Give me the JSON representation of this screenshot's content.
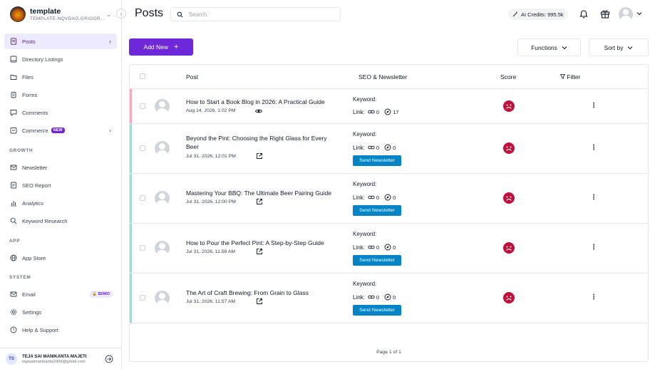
{
  "sidebar": {
    "brand_name": "template",
    "brand_subtitle": "TEMPLATE-NQVDAG.GRIGOR...",
    "items": [
      {
        "label": "Posts"
      },
      {
        "label": "Directory Listings"
      },
      {
        "label": "Files"
      },
      {
        "label": "Forms"
      },
      {
        "label": "Comments"
      },
      {
        "label": "Commerce",
        "badge": "NEW"
      },
      {
        "label": "Newsletter"
      },
      {
        "label": "SEO Report"
      },
      {
        "label": "Analytics"
      },
      {
        "label": "Keyword Research"
      },
      {
        "label": "App Store"
      },
      {
        "label": "Email",
        "badge": "$5/MO"
      },
      {
        "label": "Settings"
      },
      {
        "label": "Help & Support"
      }
    ],
    "sections": {
      "growth": "GROWTH",
      "app": "APP",
      "system": "SYSTEM"
    },
    "user": {
      "initials": "TS",
      "name": "TEJA SAI MANIKANTA MAJETI",
      "email": "tejasaimanikanta2004@gmail.com"
    }
  },
  "header": {
    "title": "Posts",
    "search_placeholder": "Search",
    "ai_credits": "AI Credits: 995.5k"
  },
  "toolbar": {
    "add_new": "Add New",
    "functions": "Functions",
    "sort_by": "Sort by"
  },
  "table": {
    "headers": {
      "post": "Post",
      "seo": "SEO & Newsletter",
      "score": "Score",
      "filter": "Filter"
    },
    "keyword_label": "Keyword:",
    "link_label": "Link:",
    "send_label": "Send Newsletter",
    "rows": [
      {
        "title": "How to Start a Book Blog in 2026: A Practical Guide",
        "date": "Aug 14, 2026, 1:02 PM",
        "links": "0",
        "views": "17",
        "status_color": "#f9a8b8"
      },
      {
        "title": "Beyond the Pint: Choosing the Right Glass for Every Beer",
        "date": "Jul 31, 2026, 12:01 PM",
        "links": "0",
        "views": "0",
        "status_color": "#a5d8d8"
      },
      {
        "title": "Mastering Your BBQ: The Ultimate Beer Pairing Guide",
        "date": "Jul 31, 2026, 12:00 PM",
        "links": "0",
        "views": "0",
        "status_color": "#a5d8d8"
      },
      {
        "title": "How to Pour the Perfect Pint: A Step-by-Step Guide",
        "date": "Jul 31, 2026, 11:58 AM",
        "links": "0",
        "views": "0",
        "status_color": "#a5d8d8"
      },
      {
        "title": "The Art of Craft Brewing: From Grain to Glass",
        "date": "Jul 31, 2026, 11:57 AM",
        "links": "0",
        "views": "0",
        "status_color": "#a5d8d8"
      }
    ],
    "pagination": "Page 1 of 1"
  },
  "colors": {
    "accent": "#6d28d9",
    "send_button": "#0284c7",
    "score_bad": "#be123c"
  }
}
